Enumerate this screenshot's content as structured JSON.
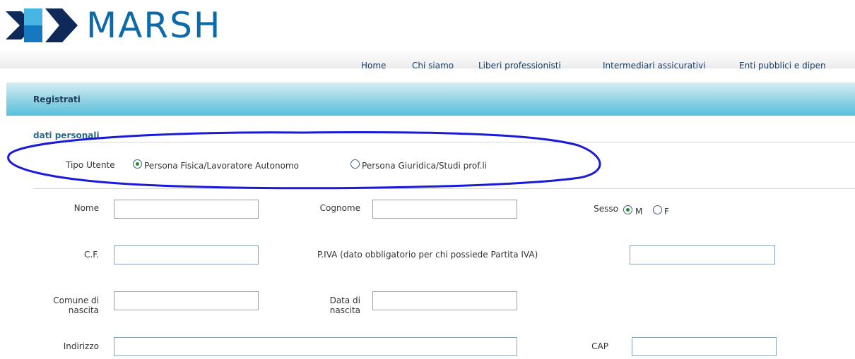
{
  "logo": {
    "text": "MARSH"
  },
  "nav": {
    "items": [
      "Home",
      "Chi siamo",
      "Liberi professionisti",
      "Intermediari assicurativi",
      "Enti pubblici e dipen"
    ]
  },
  "form": {
    "title": "Registrati",
    "section": "dati personali",
    "tipo_utente": {
      "label": "Tipo Utente",
      "options": [
        "Persona Fisica/Lavoratore Autonomo",
        "Persona Giuridica/Studi prof.li"
      ],
      "selected": "Persona Fisica/Lavoratore Autonomo"
    },
    "fields": {
      "nome": {
        "label": "Nome",
        "value": ""
      },
      "cognome": {
        "label": "Cognome",
        "value": ""
      },
      "sesso": {
        "label": "Sesso",
        "options": [
          "M",
          "F"
        ],
        "selected": "M"
      },
      "cf": {
        "label": "C.F.",
        "value": ""
      },
      "piva": {
        "label": "P.IVA (dato obbligatorio per chi possiede Partita IVA)",
        "value": ""
      },
      "comune_nascita": {
        "label": "Comune di nascita",
        "value": ""
      },
      "data_nascita": {
        "label": "Data di nascita",
        "value": ""
      },
      "indirizzo": {
        "label": "Indirizzo",
        "value": ""
      },
      "cap": {
        "label": "CAP",
        "value": ""
      }
    }
  },
  "colors": {
    "brand_blue": "#0b6aa7",
    "logo_dark": "#0f2a58",
    "logo_mid": "#1679bf",
    "logo_light": "#48b5e3",
    "header_band": "#58c0db",
    "annotation_ellipse": "#1a1ad8",
    "radio_checked": "#2a8a2a"
  }
}
